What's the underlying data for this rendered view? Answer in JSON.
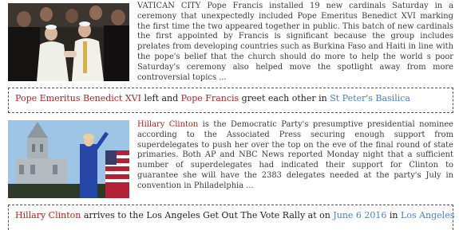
{
  "story1": {
    "text": "VATICAN CITY Pope Francis installed 19 new cardinals Saturday in a ceremony that unexpectedly included Pope Emeritus Benedict XVI marking the first time the two appeared together in public. This batch of new cardinals the first appointed by Francis is significant because the group includes prelates from developing countries such as Burkina Faso and Haiti in line with the pope's belief that the church should do more to help the world s poor Saturday's ceremony also helped move the spotlight away from more controversial topics ...",
    "caption": {
      "person1": "Pope Emeritus Benedict XVI",
      "mid1": " left and ",
      "person2": "Pope Francis",
      "mid2": " greet each other in ",
      "place": "St Peter's Basilica"
    }
  },
  "story2": {
    "highlight": "Hillary Clinton",
    "text": " is the Democratic Party's presumptive presidential nominee according to the Associated Press securing enough support from superdelegates to push her over the top on the eve of the final round of state primaries. Both AP and NBC News reported Monday night that a sufficient number of superdelegates had indicated their support for Clinton to guarantee she will have the 2383 delegates needed at the party's July in convention in Philadelphia ...",
    "caption": {
      "person": "Hillary Clinton",
      "mid1": " arrives to the Los Angeles Get Out The Vote Rally at on ",
      "date": "June 6 2016",
      "mid2": " in ",
      "place": "Los Angeles"
    }
  },
  "colors": {
    "entity_person": "#b22222",
    "entity_place_date": "#4a7fc1"
  }
}
